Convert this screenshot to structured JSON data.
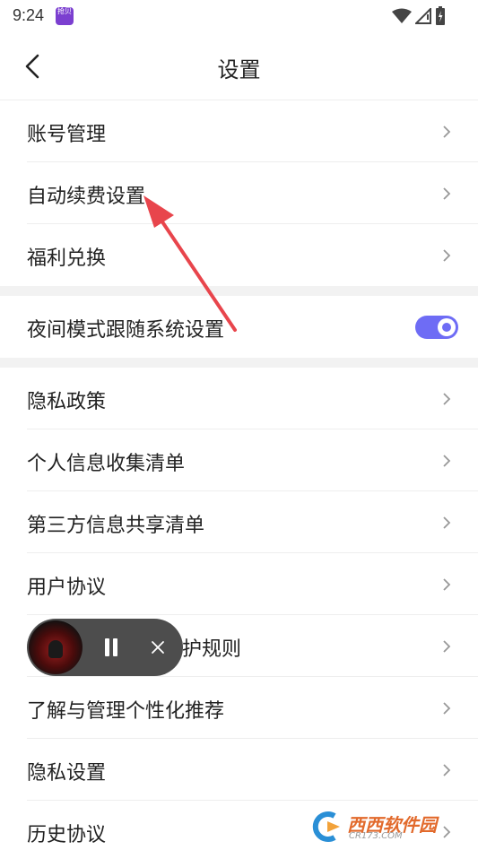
{
  "status_bar": {
    "time": "9:24",
    "app_badge": "抢贝"
  },
  "header": {
    "title": "设置"
  },
  "group1": [
    {
      "label": "账号管理"
    },
    {
      "label": "自动续费设置"
    },
    {
      "label": "福利兑换"
    }
  ],
  "night_mode": {
    "label": "夜间模式跟随系统设置",
    "enabled": true
  },
  "group3": [
    {
      "label": "隐私政策"
    },
    {
      "label": "个人信息收集清单"
    },
    {
      "label": "第三方信息共享清单"
    },
    {
      "label": "用户协议"
    },
    {
      "label": "护规则"
    },
    {
      "label": "了解与管理个性化推荐"
    },
    {
      "label": "隐私设置"
    },
    {
      "label": "历史协议"
    }
  ],
  "watermark": {
    "brand": "西西软件园",
    "domain": "CR173.COM"
  },
  "colors": {
    "accent": "#6e6cf5",
    "annotation_arrow": "#e8454c"
  }
}
